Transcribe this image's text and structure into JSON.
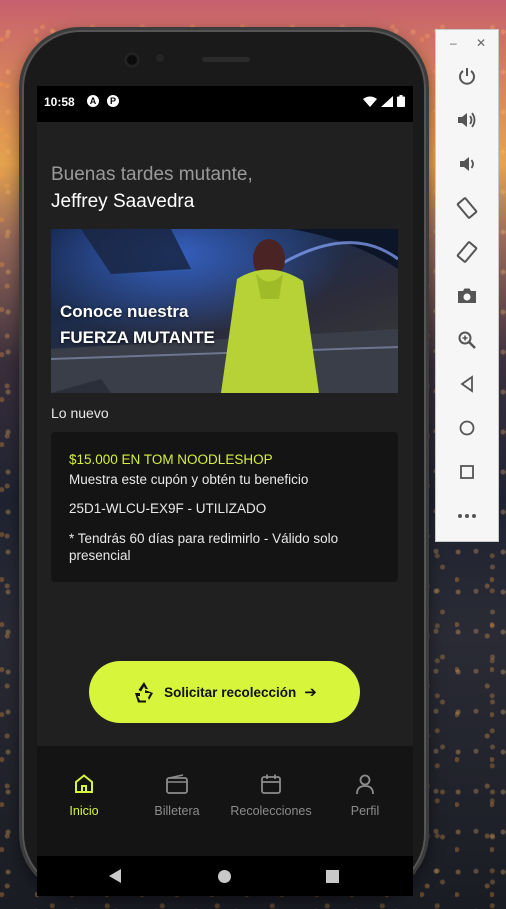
{
  "status": {
    "time": "10:58"
  },
  "greeting": {
    "line1": "Buenas tardes mutante,",
    "line2": "Jeffrey Saavedra"
  },
  "banner": {
    "title_line1": "Conoce nuestra",
    "title_line2": "FUERZA MUTANTE"
  },
  "section_title": "Lo nuevo",
  "coupon": {
    "title": "$15.000 EN TOM NOODLESHOP",
    "subtitle": "Muestra este cupón y obtén tu beneficio",
    "code": "25D1-WLCU-EX9F - UTILIZADO",
    "note": "* Tendrás 60 días para redimirlo - Válido solo presencial"
  },
  "cta": {
    "label": "Solicitar recolección"
  },
  "bottom_nav": [
    {
      "label": "Inicio",
      "icon": "home-icon",
      "active": true
    },
    {
      "label": "Billetera",
      "icon": "wallet-icon",
      "active": false
    },
    {
      "label": "Recolecciones",
      "icon": "calendar-icon",
      "active": false
    },
    {
      "label": "Perfil",
      "icon": "user-icon",
      "active": false
    }
  ],
  "colors": {
    "accent": "#d7f53a",
    "background": "#202020",
    "card": "#141414"
  },
  "emulator_tools": [
    "power-icon",
    "volume-up-icon",
    "volume-down-icon",
    "rotate-left-icon",
    "rotate-right-icon",
    "camera-icon",
    "zoom-icon",
    "back-icon",
    "home-circle-icon",
    "overview-square-icon",
    "more-icon"
  ]
}
